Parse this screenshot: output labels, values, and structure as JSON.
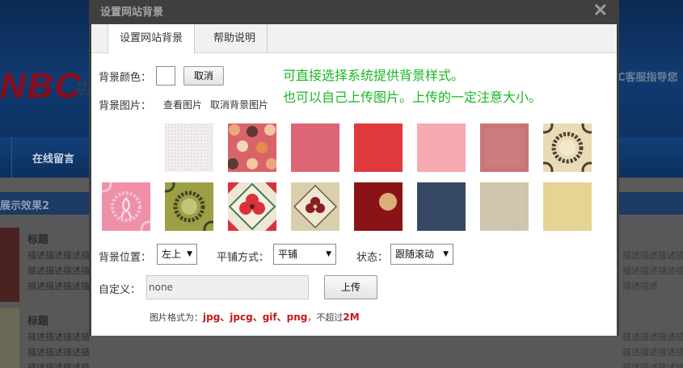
{
  "background_site": {
    "logo_text": "NBC",
    "slogan": "功",
    "right_text": "C客服指导您",
    "nav_item": "在线留言",
    "section_title": "展示效果2",
    "item_title": "标题",
    "desc_text": "描述描述描述描",
    "desc_text_right": "描述描述描述描",
    "desc_text_short": "描述描述"
  },
  "dialog": {
    "title": "设置网站背景",
    "close_glyph": "✕",
    "tabs": [
      {
        "label": "设置网站背景"
      },
      {
        "label": "帮助说明"
      }
    ],
    "bg_color_label": "背景颜色：",
    "cancel_label": "取消",
    "bg_image_label": "背景图片：",
    "view_image_link": "查看图片",
    "cancel_bg_link": "取消背景图片",
    "hint_line1": "可直接选择系统提供背景样式。",
    "hint_line2": "也可以自己上传图片。上传的一定注意大小。",
    "position_label": "背景位置：",
    "position_value": "左上",
    "tile_label": "平铺方式：",
    "tile_value": "平铺",
    "state_label": "状态：",
    "state_value": "跟随滚动",
    "custom_label": "自定义：",
    "custom_value": "none",
    "upload_label": "上传",
    "format_prefix": "图片格式为：",
    "format_types": "jpg、jpcg、gif、png",
    "format_mid": "，不超过",
    "format_size": "2M"
  },
  "swatches": [
    {
      "name": "white-linen",
      "color": "#f1eded"
    },
    {
      "name": "polka-dots",
      "color": "#d86a6e"
    },
    {
      "name": "rose-pink",
      "color": "#d9606f"
    },
    {
      "name": "crimson",
      "color": "#e03a3c"
    },
    {
      "name": "light-pink",
      "color": "#f5a8ae"
    },
    {
      "name": "dusty-rose",
      "color": "#c97779"
    },
    {
      "name": "cream-wreath",
      "color": "#e6dcb5"
    },
    {
      "name": "pink-ribbon",
      "color": "#ee8fa8"
    },
    {
      "name": "olive-wreath",
      "color": "#9a9d45"
    },
    {
      "name": "red-floral-tile",
      "color": "#d8473f"
    },
    {
      "name": "beige-floral-tile",
      "color": "#ddd3b0"
    },
    {
      "name": "dark-red-dot",
      "color": "#8c1418"
    },
    {
      "name": "navy-texture",
      "color": "#34455f"
    },
    {
      "name": "tan-canvas",
      "color": "#d3c7b1"
    },
    {
      "name": "sand-paper",
      "color": "#e3d08e"
    }
  ],
  "colors": {
    "hint_green": "#19b822",
    "format_red": "#c31a1a"
  }
}
